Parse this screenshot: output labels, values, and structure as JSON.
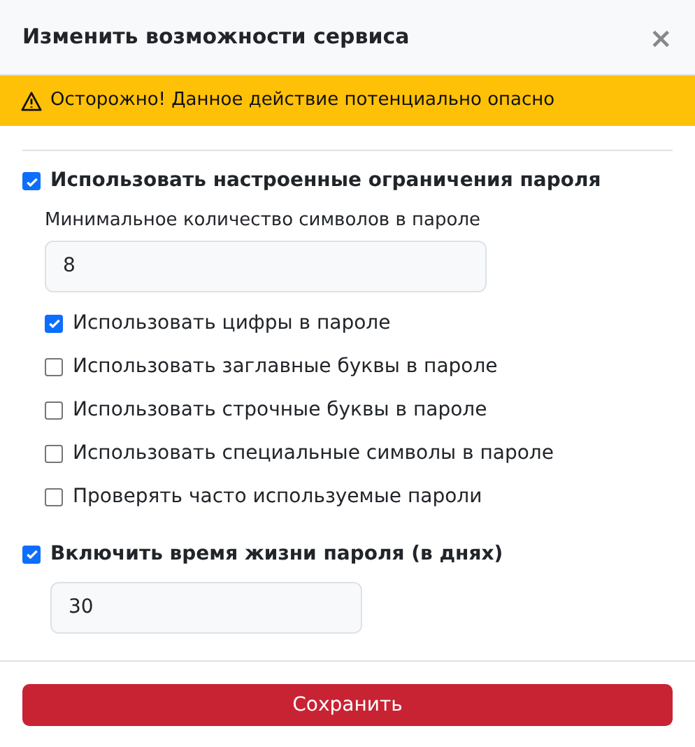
{
  "dialog": {
    "title": "Изменить возможности сервиса",
    "close": "×"
  },
  "warning": {
    "text": "Осторожно! Данное действие потенциально опасно"
  },
  "password_policy": {
    "label": "Использовать настроенные ограничения пароля",
    "checked": true,
    "min_length": {
      "label": "Минимальное количество символов в пароле",
      "value": "8"
    },
    "options": [
      {
        "label": "Использовать цифры в пароле",
        "checked": true
      },
      {
        "label": "Использовать заглавные буквы в пароле",
        "checked": false
      },
      {
        "label": "Использовать строчные буквы в пароле",
        "checked": false
      },
      {
        "label": "Использовать специальные символы в пароле",
        "checked": false
      },
      {
        "label": "Проверять часто используемые пароли",
        "checked": false
      }
    ]
  },
  "lifetime": {
    "label": "Включить время жизни пароля (в днях)",
    "checked": true,
    "value": "30"
  },
  "save_button": "Сохранить"
}
